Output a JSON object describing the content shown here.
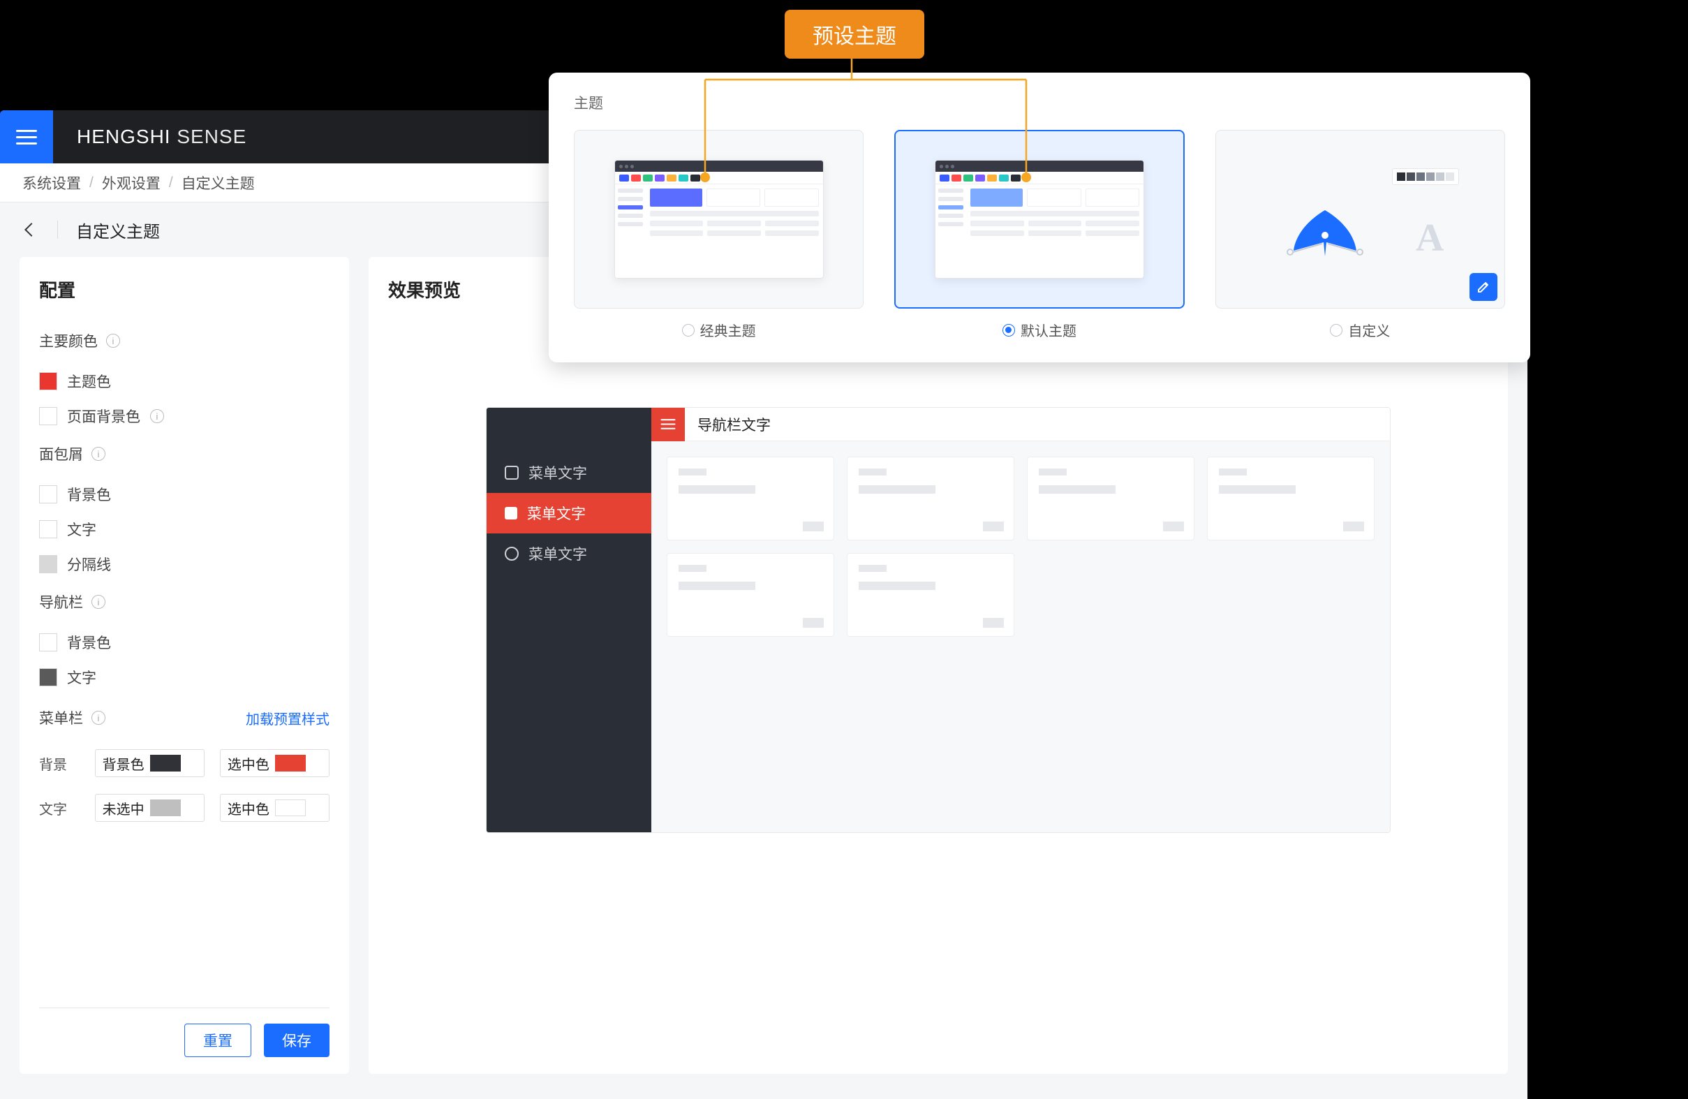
{
  "annotation": {
    "label": "预设主题"
  },
  "brand": {
    "bold": "HENGSHI",
    "light": " SENSE"
  },
  "breadcrumb": {
    "items": [
      "系统设置",
      "外观设置",
      "自定义主题"
    ]
  },
  "subheader": {
    "title": "自定义主题"
  },
  "config": {
    "heading": "配置",
    "primary_color": {
      "title": "主要颜色",
      "theme_color": "主题色",
      "page_bg": "页面背景色"
    },
    "breadcrumb_group": {
      "title": "面包屑",
      "bg": "背景色",
      "text": "文字",
      "divider": "分隔线"
    },
    "navbar": {
      "title": "导航栏",
      "bg": "背景色",
      "text": "文字"
    },
    "menubar": {
      "title": "菜单栏",
      "load_preset": "加载预置样式",
      "bg_label": "背景",
      "text_label": "文字",
      "bg_color": "背景色",
      "bg_selected": "选中色",
      "text_unselected": "未选中",
      "text_selected": "选中色"
    },
    "buttons": {
      "reset": "重置",
      "save": "保存"
    }
  },
  "preview": {
    "heading": "效果预览",
    "mock": {
      "nav_text": "导航栏文字",
      "menu_items": [
        "菜单文字",
        "菜单文字",
        "菜单文字"
      ],
      "active_index": 1
    }
  },
  "theme_panel": {
    "title": "主题",
    "options": [
      {
        "label": "经典主题",
        "selected": false
      },
      {
        "label": "默认主题",
        "selected": true
      },
      {
        "label": "自定义",
        "selected": false
      }
    ]
  },
  "colors": {
    "palette": [
      "#2a2e37",
      "#4a4f5b",
      "#6b7280",
      "#9aa1ad",
      "#c6cbd4",
      "#e5e7eb"
    ]
  }
}
